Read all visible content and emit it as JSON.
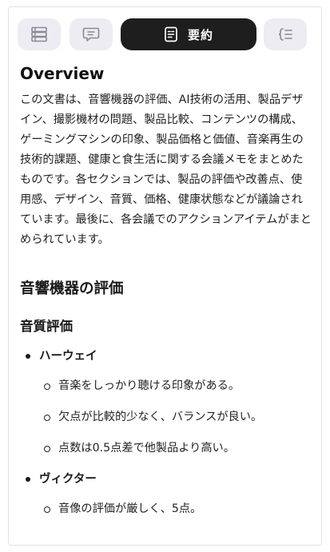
{
  "toolbar": {
    "list_icon": "list-view-icon",
    "chat_icon": "chat-bubble-icon",
    "summary_icon": "summary-doc-icon",
    "summary_label": "要約",
    "outline_icon": "outline-icon"
  },
  "colors": {
    "active_button": "#1e1e1e",
    "inactive_button": "#ececf2",
    "text": "#1a1a1a"
  },
  "main": {
    "overview_title": "Overview",
    "overview_text": "この文書は、音響機器の評価、AI技術の活用、製品デザイン、撮影機材の問題、製品比較、コンテンツの構成、ゲーミングマシンの印象、製品価格と価値、音楽再生の技術的課題、健康と食生活に関する会議メモをまとめたものです。各セクションでは、製品の評価や改善点、使用感、デザイン、音質、価格、健康状態などが議論されています。最後に、各会議でのアクションアイテムがまとめられています。",
    "section_title": "音響機器の評価",
    "subsection_title": "音質評価",
    "brands": [
      {
        "name": "ハーウェイ",
        "points": [
          "音楽をしっかり聴ける印象がある。",
          "欠点が比較的少なく、バランスが良い。",
          "点数は0.5点差で他製品より高い。"
        ]
      },
      {
        "name": "ヴィクター",
        "points": [
          "音像の評価が厳しく、5点。"
        ]
      }
    ]
  }
}
